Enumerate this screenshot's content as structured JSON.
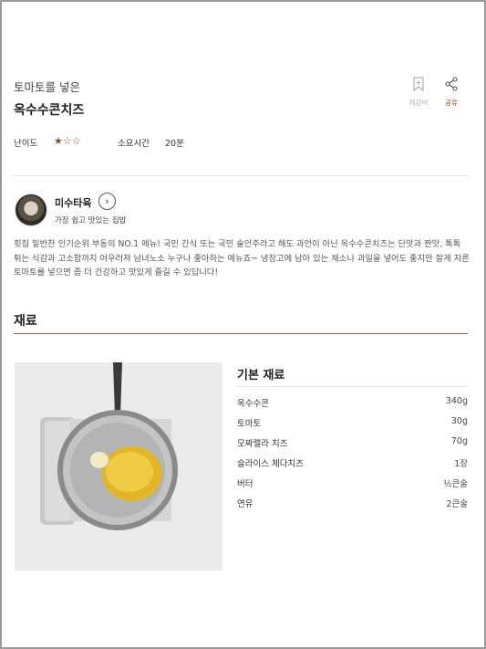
{
  "recipe": {
    "subtitle": "토마토를 넣은",
    "title": "옥수수콘치즈",
    "actions": {
      "bookmark_label": "레깅비",
      "share_label": "공유"
    },
    "meta": {
      "difficulty_label": "난이도",
      "difficulty_rating": 1,
      "difficulty_max": 5,
      "time_label": "소요시간",
      "time_value": "20분"
    }
  },
  "author": {
    "name": "미수타육",
    "description": "가장 쉽고 맛있는 집밥"
  },
  "intro": "횟집 밑반찬 인기순위 부동의 NO.1 메뉴! 국민 간식 또는 국민 술안주라고 해도 과언이 아닌 옥수수콘치즈는 단맛과 짠맛, 톡톡 튀는 식감과 고소함까지 어우러져 남녀노소 누구나 좋아하는 메뉴죠~ 냉장고에 남아 있는 채소나 과일을 넣어도 좋지만 잘게 자른 토마토를 넣으면 좀 더 건강하고 맛있게 즐길 수 있답니다!",
  "ingredients_section": {
    "title": "재료",
    "group_title": "기본 재료",
    "items": [
      {
        "name": "옥수수콘",
        "amount": "340g"
      },
      {
        "name": "토마토",
        "amount": "30g"
      },
      {
        "name": "모짜렐라 치즈",
        "amount": "70g"
      },
      {
        "name": "슬라이스 체다치즈",
        "amount": "1장"
      },
      {
        "name": "버터",
        "amount": "½큰술"
      },
      {
        "name": "연유",
        "amount": "2큰술"
      }
    ]
  },
  "colors": {
    "accent": "#8a4b2b",
    "divider": "#e5e5e5",
    "section_divider": "#7a6a5e"
  }
}
